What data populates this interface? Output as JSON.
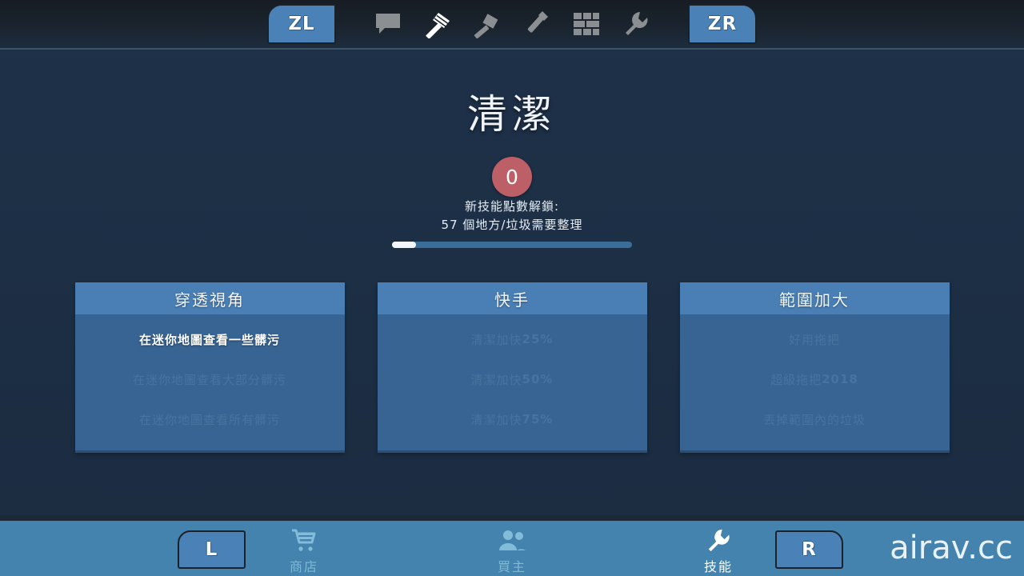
{
  "topbar": {
    "left_shoulder": "ZL",
    "right_shoulder": "ZR",
    "tools": [
      {
        "icon": "speech-bubble-icon",
        "name": "chat",
        "active": false
      },
      {
        "icon": "squeegee-icon",
        "name": "clean",
        "active": true
      },
      {
        "icon": "hammer-icon",
        "name": "build",
        "active": false
      },
      {
        "icon": "paintbrush-icon",
        "name": "paint",
        "active": false
      },
      {
        "icon": "brick-wall-icon",
        "name": "tiles",
        "active": false
      },
      {
        "icon": "wrench-icon",
        "name": "repair",
        "active": false
      }
    ]
  },
  "page": {
    "title": "清潔",
    "points": "0",
    "unlock_label": "新技能點數解鎖:",
    "unlock_requirement": "57 個地方/垃圾需要整理",
    "progress_percent": 10
  },
  "cards": [
    {
      "title": "穿透視角",
      "rows": [
        {
          "text": "在迷你地圖查看一些髒污",
          "unlocked": true
        },
        {
          "text": "在迷你地圖查看大部分髒污",
          "unlocked": false
        },
        {
          "text": "在迷你地圖查看所有髒污",
          "unlocked": false
        }
      ]
    },
    {
      "title": "快手",
      "rows": [
        {
          "text": "清潔加快",
          "suffix": "25%",
          "unlocked": false
        },
        {
          "text": "清潔加快",
          "suffix": "50%",
          "unlocked": false
        },
        {
          "text": "清潔加快",
          "suffix": "75%",
          "unlocked": false
        }
      ]
    },
    {
      "title": "範圍加大",
      "rows": [
        {
          "text": "好用拖把",
          "unlocked": false
        },
        {
          "text": "超級拖把",
          "suffix": "2018",
          "unlocked": false
        },
        {
          "text": "丟掉範圍內的垃圾",
          "unlocked": false
        }
      ]
    }
  ],
  "bottombar": {
    "left_bumper": "L",
    "right_bumper": "R",
    "items": [
      {
        "icon": "shopping-cart-icon",
        "label": "商店",
        "active": false
      },
      {
        "icon": "buyers-people-icon",
        "label": "買主",
        "active": false
      },
      {
        "icon": "wrench-icon",
        "label": "技能",
        "active": true
      }
    ]
  },
  "watermark": "airav.cc",
  "colors": {
    "background": "#1d2f45",
    "accent_blue": "#4a82b8",
    "card_header": "#4a7fb5",
    "card_body": "#376493",
    "points_badge": "#bc5f66",
    "bottom_bar": "#4383ae",
    "progress_fill": "#f4f7fa"
  }
}
